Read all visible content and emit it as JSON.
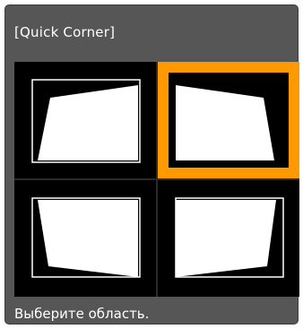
{
  "dialog": {
    "title": "[Quick Corner]",
    "status": "Выберите область.",
    "accent_color": "#ff9900",
    "selected_corner": "top-right"
  },
  "corners": [
    {
      "id": "top-left",
      "icon": "keystone-top-left-icon"
    },
    {
      "id": "top-right",
      "icon": "keystone-top-right-icon"
    },
    {
      "id": "bottom-left",
      "icon": "keystone-bottom-left-icon"
    },
    {
      "id": "bottom-right",
      "icon": "keystone-bottom-right-icon"
    }
  ]
}
